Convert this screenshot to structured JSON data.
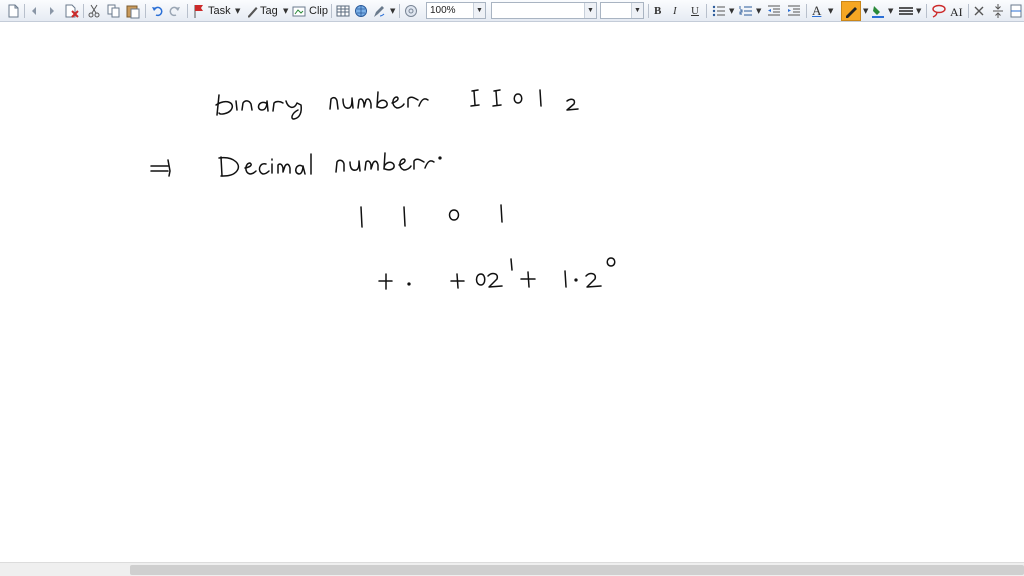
{
  "toolbar": {
    "task_label": "Task",
    "tag_label": "Tag",
    "clip_label": "Clip",
    "zoom_value": "100%",
    "font_name_value": "",
    "font_size_value": "",
    "bold_label": "B",
    "italic_label": "I",
    "underline_label": "U",
    "font_color_label": "A"
  },
  "colors": {
    "highlight": "#f5a623",
    "ink": "#000000",
    "red_icon": "#cc2a2a",
    "accent_blue": "#2a6fd6"
  }
}
